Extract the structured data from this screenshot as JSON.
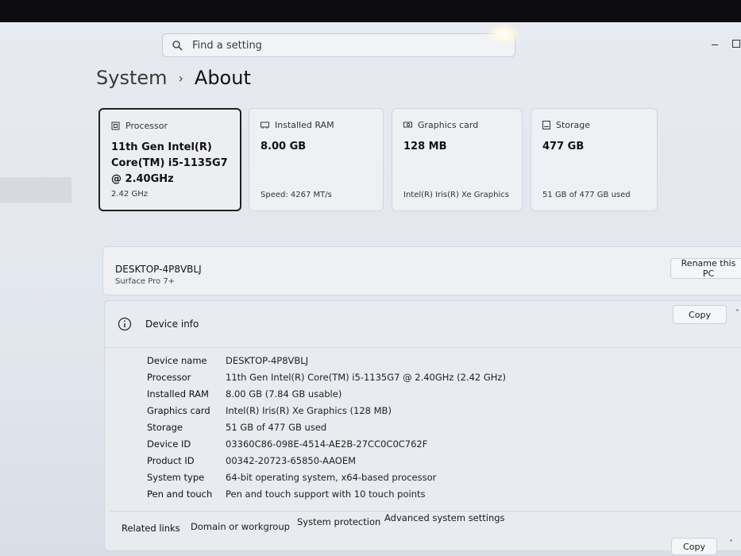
{
  "search": {
    "placeholder": "Find a setting"
  },
  "breadcrumb": {
    "parent": "System",
    "separator": "›",
    "current": "About"
  },
  "cards": [
    {
      "title": "Processor",
      "value": "11th Gen Intel(R) Core(TM) i5-1135G7 @ 2.40GHz",
      "sub": "2.42 GHz",
      "icon": "processor-icon"
    },
    {
      "title": "Installed RAM",
      "value": "8.00 GB",
      "sub": "Speed: 4267 MT/s",
      "icon": "ram-icon"
    },
    {
      "title": "Graphics card",
      "value": "128 MB",
      "sub": "Intel(R) Iris(R) Xe Graphics",
      "icon": "graphics-card-icon"
    },
    {
      "title": "Storage",
      "value": "477 GB",
      "sub": "51 GB of 477 GB used",
      "icon": "storage-icon"
    }
  ],
  "pc": {
    "name": "DESKTOP-4P8VBLJ",
    "model": "Surface Pro 7+",
    "rename_label": "Rename this PC"
  },
  "device_info": {
    "title": "Device info",
    "copy_label": "Copy",
    "specs": [
      {
        "key": "Device name",
        "value": "DESKTOP-4P8VBLJ"
      },
      {
        "key": "Processor",
        "value": "11th Gen Intel(R) Core(TM) i5-1135G7 @ 2.40GHz (2.42 GHz)"
      },
      {
        "key": "Installed RAM",
        "value": "8.00 GB (7.84 GB usable)"
      },
      {
        "key": "Graphics card",
        "value": "Intel(R) Iris(R) Xe Graphics (128 MB)"
      },
      {
        "key": "Storage",
        "value": "51 GB of 477 GB used"
      },
      {
        "key": "Device ID",
        "value": "03360C86-098E-4514-AE2B-27CC0C0C762F"
      },
      {
        "key": "Product ID",
        "value": "00342-20723-65850-AAOEM"
      },
      {
        "key": "System type",
        "value": "64-bit operating system, x64-based processor"
      },
      {
        "key": "Pen and touch",
        "value": "Pen and touch support with 10 touch points"
      }
    ]
  },
  "related": {
    "label": "Related links",
    "links": [
      "Domain or workgroup",
      "System protection",
      "Advanced system settings"
    ]
  },
  "bottom_copy_label": "Copy"
}
